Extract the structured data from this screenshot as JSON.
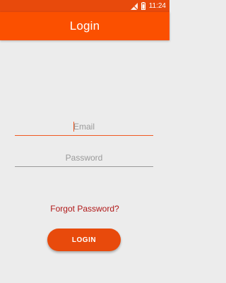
{
  "status_bar": {
    "time": "11:24",
    "icons": [
      "signal-icon",
      "battery-icon"
    ],
    "color": "#e84a0c"
  },
  "app_bar": {
    "title": "Login",
    "color": "#fb5000"
  },
  "form": {
    "email_placeholder": "Email",
    "email_value": "",
    "password_placeholder": "Password",
    "password_value": "",
    "forgot_label": "Forgot Password?",
    "login_label": "LOGIN"
  },
  "colors": {
    "accent": "#e84a0c",
    "link": "#b01818",
    "background": "#ececec"
  }
}
